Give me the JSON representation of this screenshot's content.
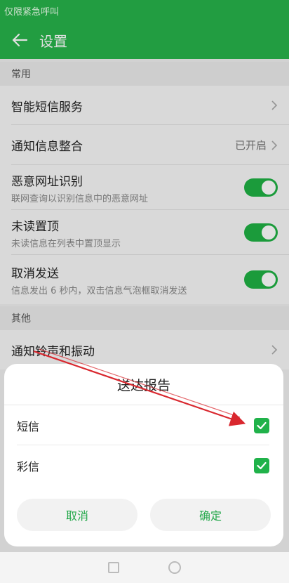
{
  "status_bar": {
    "text": "仅限紧急呼叫"
  },
  "app_bar": {
    "title": "设置",
    "back_icon": "arrow-left-icon"
  },
  "sections": {
    "common": "常用",
    "other": "其他"
  },
  "items": {
    "smart_sms": {
      "title": "智能短信服务"
    },
    "notification_merge": {
      "title": "通知信息整合",
      "value": "已开启"
    },
    "malicious_url": {
      "title": "恶意网址识别",
      "subtitle": "联网查询以识别信息中的恶意网址",
      "enabled": true
    },
    "unread_top": {
      "title": "未读置顶",
      "subtitle": "未读信息在列表中置顶显示",
      "enabled": true
    },
    "cancel_send": {
      "title": "取消发送",
      "subtitle": "信息发出 6 秒内，双击信息气泡框取消发送",
      "enabled": true
    },
    "ringtone": {
      "title": "通知铃声和振动"
    }
  },
  "dialog": {
    "title": "送达报告",
    "options": [
      {
        "label": "短信",
        "checked": true
      },
      {
        "label": "彩信",
        "checked": true
      }
    ],
    "cancel_label": "取消",
    "ok_label": "确定"
  },
  "colors": {
    "accent": "#27b34a",
    "toggle_on": "#1fb144",
    "annotation_arrow": "#d9272e"
  }
}
